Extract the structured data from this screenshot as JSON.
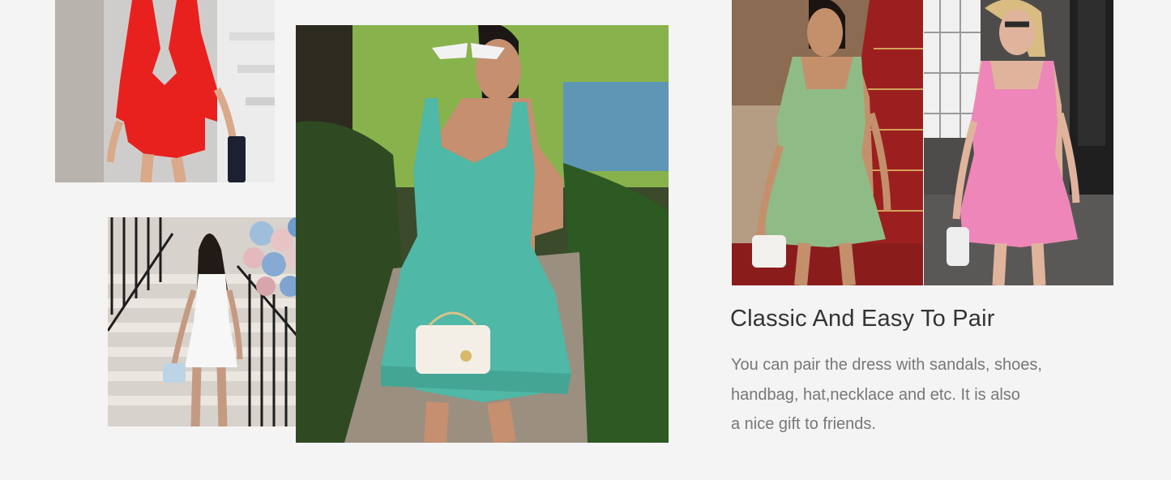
{
  "feature": {
    "heading": "Classic And Easy To Pair",
    "description_lines": [
      "You can pair the dress with sandals, shoes,",
      "handbag, hat,necklace and etc. It is also",
      "a nice gift to friends."
    ]
  },
  "photos": [
    {
      "name": "red-dress-photo",
      "dress_color": "#e8211f"
    },
    {
      "name": "white-dress-photo",
      "dress_color": "#f7f7f7"
    },
    {
      "name": "teal-dress-photo",
      "dress_color": "#4fb8a6"
    },
    {
      "name": "green-dress-photo",
      "dress_color": "#8fbc86"
    },
    {
      "name": "pink-dress-photo",
      "dress_color": "#ee86b9"
    }
  ]
}
